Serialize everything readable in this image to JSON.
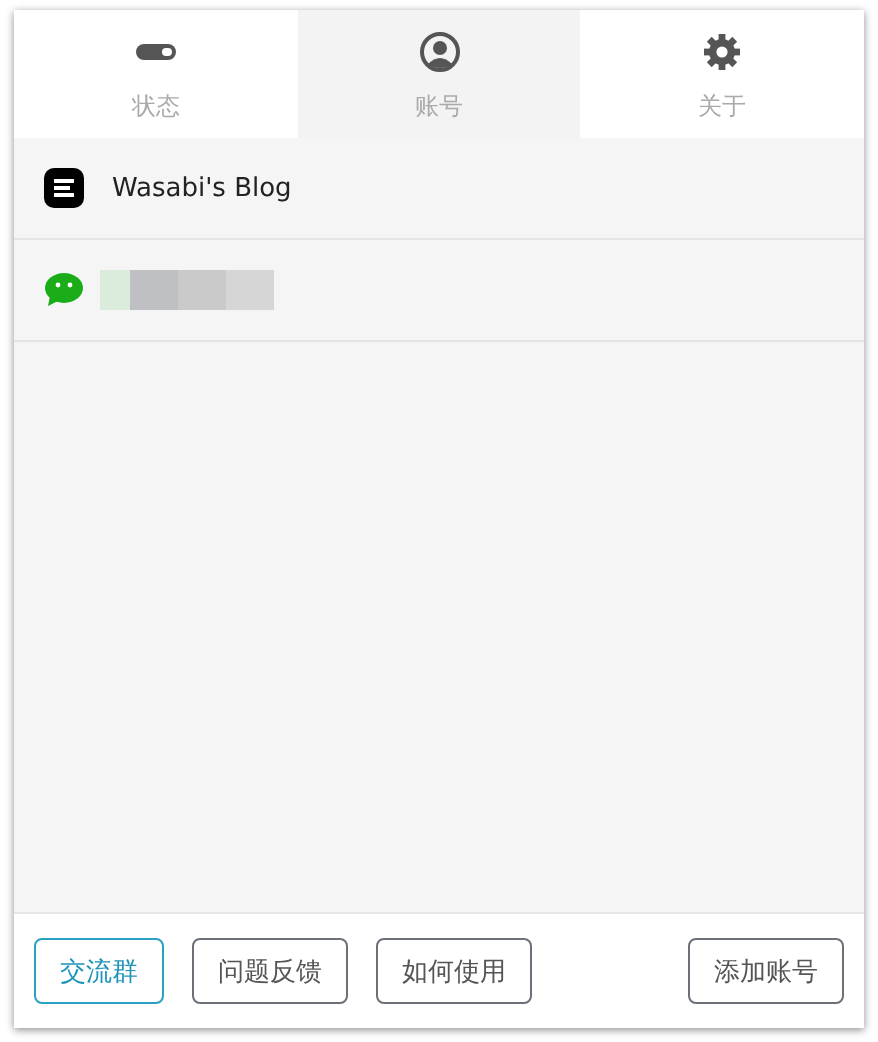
{
  "tabs": [
    {
      "label": "状态",
      "kind": "toggle",
      "selected": false
    },
    {
      "label": "账号",
      "kind": "user",
      "selected": true
    },
    {
      "label": "关于",
      "kind": "gear",
      "selected": false
    }
  ],
  "accounts": [
    {
      "kind": "blog",
      "name": "Wasabi's Blog"
    },
    {
      "kind": "wechat"
    }
  ],
  "buttons": [
    {
      "label": "交流群",
      "highlighted": true
    },
    {
      "label": "问题反馈",
      "highlighted": false
    },
    {
      "label": "如何使用",
      "highlighted": false
    }
  ],
  "add_button": "添加账号"
}
